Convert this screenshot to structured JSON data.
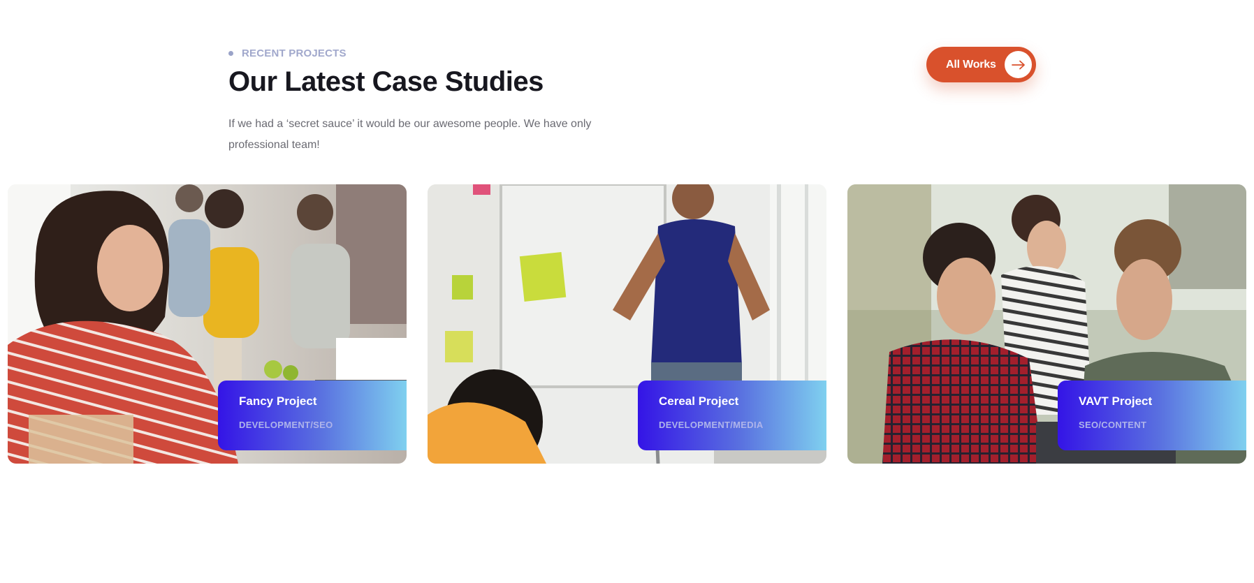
{
  "section": {
    "eyebrow": "RECENT PROJECTS",
    "title": "Our Latest Case Studies",
    "description": "If we had a ‘secret sauce’ it would be our awesome people. We have only professional team!",
    "cta_label": "All Works",
    "cta_icon": "arrow-right-icon",
    "accent_color": "#d9512c"
  },
  "projects": [
    {
      "title": "Fancy Project",
      "tags": "DEVELOPMENT/SEO",
      "image": "team-meeting-photo"
    },
    {
      "title": "Cereal Project",
      "tags": "DEVELOPMENT/MEDIA",
      "image": "presentation-whiteboard-photo"
    },
    {
      "title": "VAVT Project",
      "tags": "SEO/CONTENT",
      "image": "team-laptop-photo"
    }
  ]
}
